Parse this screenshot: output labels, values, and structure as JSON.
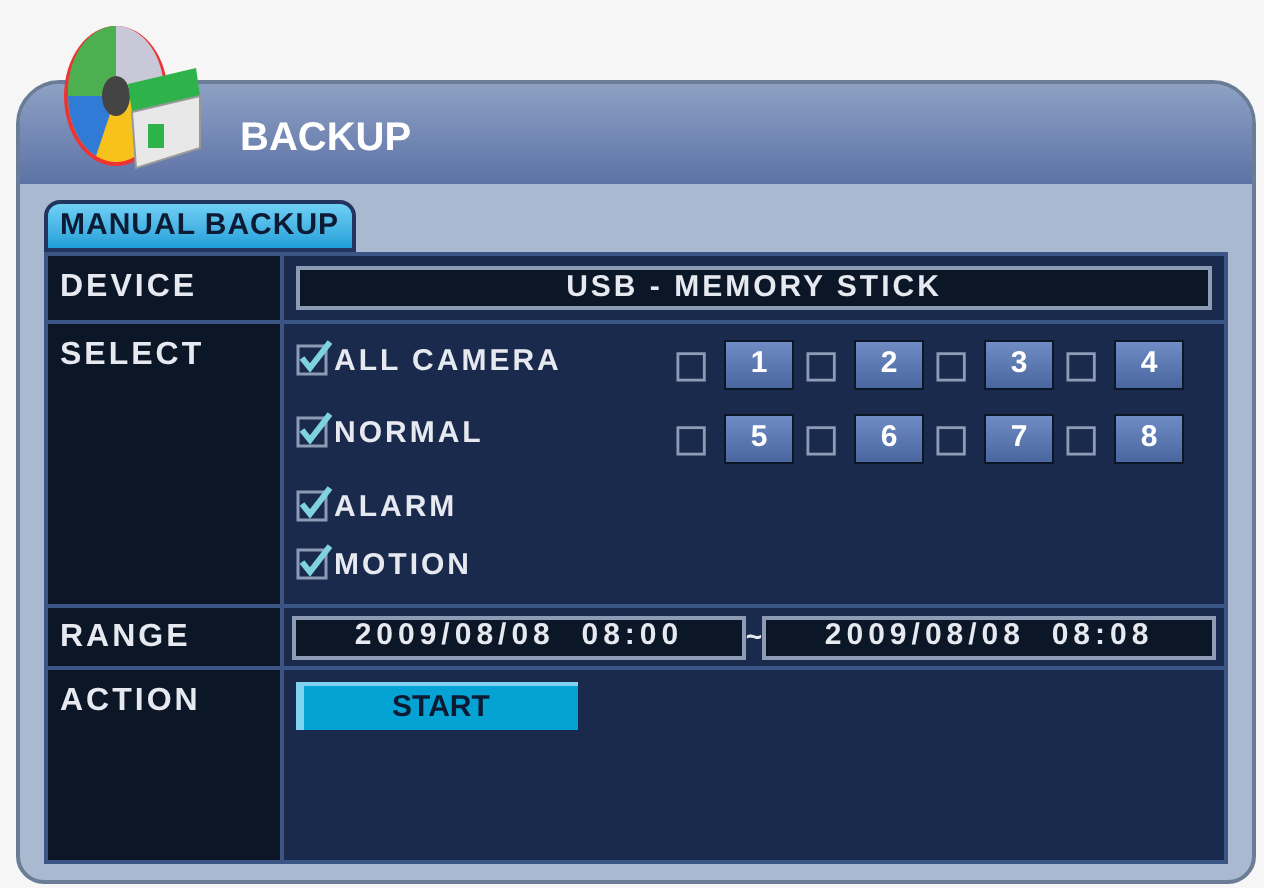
{
  "window": {
    "title": "BACKUP"
  },
  "tabs": [
    {
      "label": "MANUAL BACKUP",
      "selected": true
    }
  ],
  "device": {
    "label": "DEVICE",
    "value": "USB - MEMORY STICK"
  },
  "select": {
    "label": "SELECT",
    "options": [
      {
        "label": "ALL CAMERA",
        "checked": true
      },
      {
        "label": "NORMAL",
        "checked": true
      },
      {
        "label": "ALARM",
        "checked": true
      },
      {
        "label": "MOTION",
        "checked": true
      }
    ],
    "cameras": [
      {
        "label": "1",
        "checked": false
      },
      {
        "label": "2",
        "checked": false
      },
      {
        "label": "3",
        "checked": false
      },
      {
        "label": "4",
        "checked": false
      },
      {
        "label": "5",
        "checked": false
      },
      {
        "label": "6",
        "checked": false
      },
      {
        "label": "7",
        "checked": false
      },
      {
        "label": "8",
        "checked": false
      }
    ]
  },
  "range": {
    "label": "RANGE",
    "start": "2009/08/08  08:00",
    "separator": "~",
    "end": "2009/08/08  08:08"
  },
  "action": {
    "label": "ACTION",
    "button": "START"
  }
}
